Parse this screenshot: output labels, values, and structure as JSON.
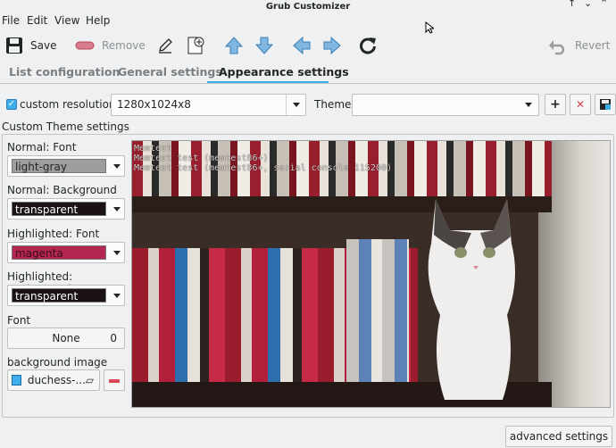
{
  "window": {
    "title": "Grub Customizer"
  },
  "menu": [
    "File",
    "Edit",
    "View",
    "Help"
  ],
  "toolbar": {
    "save_label": "Save",
    "remove_label": "Remove",
    "revert_label": "Revert"
  },
  "tabs": [
    "List configuration",
    "General settings",
    "Appearance settings"
  ],
  "resolution": {
    "checkbox_label": "custom resolution:",
    "value": "1280x1024x8",
    "theme_label": "Theme:",
    "theme_value": ""
  },
  "custom_theme": {
    "title": "Custom Theme settings",
    "normal_font_label": "Normal: Font",
    "normal_font_value": "light-gray",
    "normal_bg_label": "Normal: Background",
    "normal_bg_value": "transparent",
    "highlight_font_label": "Highlighted: Font",
    "highlight_font_value": "magenta",
    "highlight_bg_label": "Highlighted: Background",
    "highlight_bg_value": "transparent",
    "font_label": "Font",
    "font_value": "None",
    "font_size": "0",
    "bg_image_label": "background image",
    "bg_image_value": "duchess-..."
  },
  "preview": {
    "line1": "Memtest",
    "line2": "Memtest test (memtest86+)",
    "line3": "Memtest test (memtest86+, serial console 115200)"
  },
  "advanced_button": "advanced settings",
  "colors": {
    "accent": "#3daee9",
    "normal_font_swatch": "#9e9e9e",
    "normal_bg_swatch": "#1a1214",
    "highlight_font_swatch": "#b3264f",
    "highlight_bg_swatch": "#1a1214"
  }
}
